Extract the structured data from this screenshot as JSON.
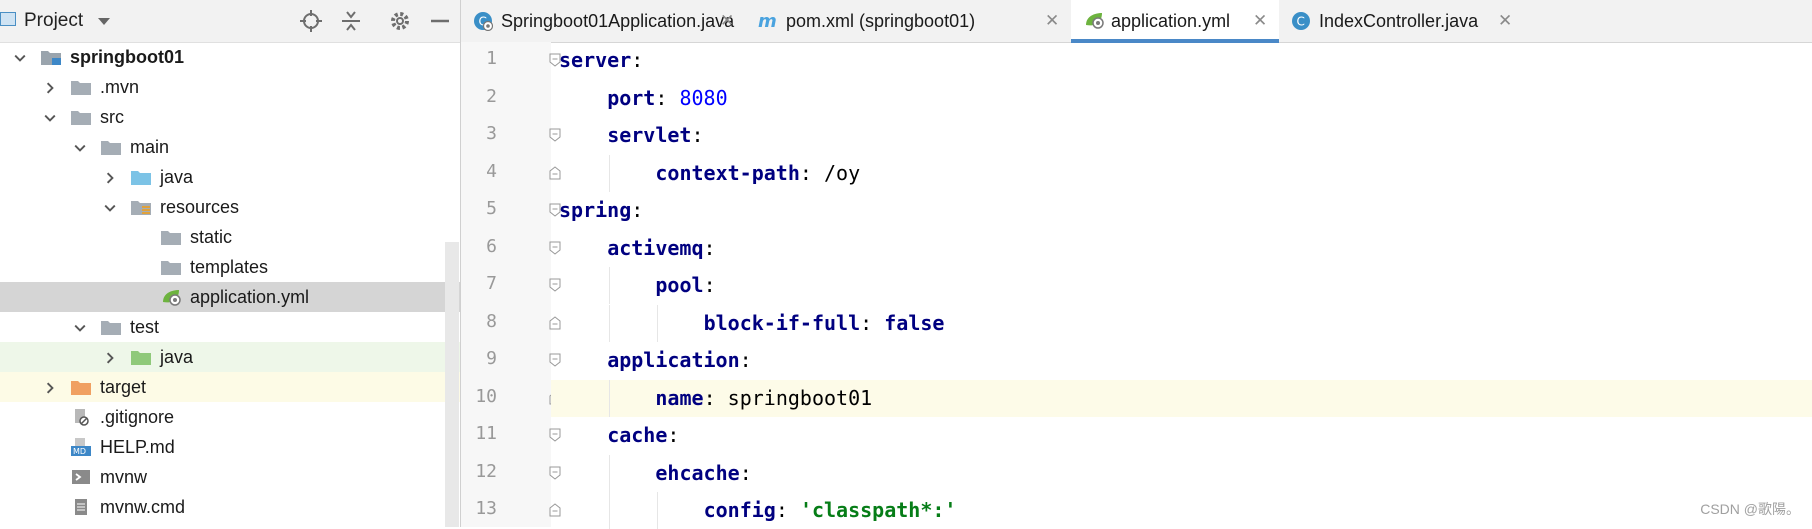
{
  "project_panel": {
    "title": "Project",
    "tree": [
      {
        "label": "springboot01",
        "bold": true,
        "chevron": "down",
        "icon": "module-folder-icon"
      },
      {
        "label": ".mvn",
        "chevron": "right",
        "icon": "folder-icon"
      },
      {
        "label": "src",
        "chevron": "down",
        "icon": "folder-icon"
      },
      {
        "label": "main",
        "chevron": "down",
        "icon": "folder-icon"
      },
      {
        "label": "java",
        "chevron": "right",
        "icon": "source-folder-icon"
      },
      {
        "label": "resources",
        "chevron": "down",
        "icon": "resources-folder-icon"
      },
      {
        "label": "static",
        "chevron": "",
        "icon": "folder-icon"
      },
      {
        "label": "templates",
        "chevron": "",
        "icon": "folder-icon"
      },
      {
        "label": "application.yml",
        "chevron": "",
        "icon": "spring-yml-icon",
        "selected": true
      },
      {
        "label": "test",
        "chevron": "down",
        "icon": "folder-icon"
      },
      {
        "label": "java",
        "chevron": "right",
        "icon": "test-folder-icon"
      },
      {
        "label": "target",
        "chevron": "right",
        "icon": "excluded-folder-icon"
      },
      {
        "label": ".gitignore",
        "chevron": "",
        "icon": "ignored-file-icon"
      },
      {
        "label": "HELP.md",
        "chevron": "",
        "icon": "markdown-file-icon"
      },
      {
        "label": "mvnw",
        "chevron": "",
        "icon": "shell-file-icon"
      },
      {
        "label": "mvnw.cmd",
        "chevron": "",
        "icon": "text-file-icon"
      }
    ]
  },
  "tabs": [
    {
      "label": "Springboot01Application.java",
      "icon": "spring-class-icon",
      "active": false
    },
    {
      "label": "pom.xml (springboot01)",
      "icon": "maven-icon",
      "active": false
    },
    {
      "label": "application.yml",
      "icon": "spring-yml-icon",
      "active": true
    },
    {
      "label": "IndexController.java",
      "icon": "class-icon",
      "active": false
    }
  ],
  "code": [
    {
      "n": "1",
      "indent": 0,
      "key": "server",
      "value": "",
      "vtype": ""
    },
    {
      "n": "2",
      "indent": 1,
      "key": "port",
      "value": "8080",
      "vtype": "num"
    },
    {
      "n": "3",
      "indent": 1,
      "key": "servlet",
      "value": "",
      "vtype": ""
    },
    {
      "n": "4",
      "indent": 2,
      "key": "context-path",
      "value": "/oy",
      "vtype": "plain"
    },
    {
      "n": "5",
      "indent": 0,
      "key": "spring",
      "value": "",
      "vtype": ""
    },
    {
      "n": "6",
      "indent": 1,
      "key": "activemq",
      "value": "",
      "vtype": ""
    },
    {
      "n": "7",
      "indent": 2,
      "key": "pool",
      "value": "",
      "vtype": ""
    },
    {
      "n": "8",
      "indent": 3,
      "key": "block-if-full",
      "value": "false",
      "vtype": "bool"
    },
    {
      "n": "9",
      "indent": 1,
      "key": "application",
      "value": "",
      "vtype": ""
    },
    {
      "n": "10",
      "indent": 2,
      "key": "name",
      "value": "springboot01",
      "vtype": "plain",
      "current": true
    },
    {
      "n": "11",
      "indent": 1,
      "key": "cache",
      "value": "",
      "vtype": ""
    },
    {
      "n": "12",
      "indent": 2,
      "key": "ehcache",
      "value": "",
      "vtype": ""
    },
    {
      "n": "13",
      "indent": 3,
      "key": "config",
      "value": "'classpath*:'",
      "vtype": "str"
    }
  ],
  "watermark": "CSDN @歌陽。",
  "colors": {
    "accent": "#4a88c7",
    "key": "#000080",
    "number": "#0000ff",
    "string": "#067d17"
  }
}
